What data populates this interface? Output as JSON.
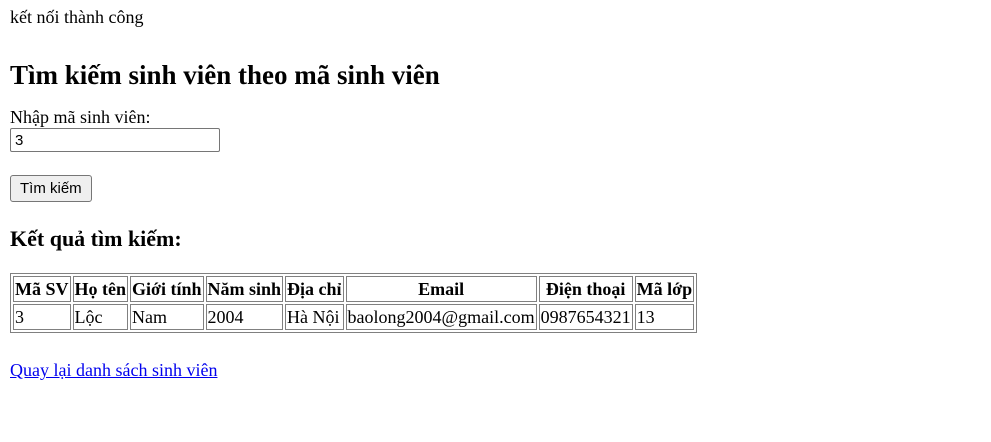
{
  "status_message": "kết nối thành công",
  "page_title": "Tìm kiếm sinh viên theo mã sinh viên",
  "search_form": {
    "label": "Nhập mã sinh viên:",
    "input_value": "3",
    "submit_label": "Tìm kiếm"
  },
  "results": {
    "heading": "Kết quả tìm kiếm:",
    "columns": [
      "Mã SV",
      "Họ tên",
      "Giới tính",
      "Năm sinh",
      "Địa chỉ",
      "Email",
      "Điện thoại",
      "Mã lớp"
    ],
    "rows": [
      [
        "3",
        "Lộc",
        "Nam",
        "2004",
        "Hà Nội",
        "baolong2004@gmail.com",
        "0987654321",
        "13"
      ]
    ]
  },
  "back_link_label": "Quay lại danh sách sinh viên",
  "colors": {
    "link": "#0000ee",
    "button_bg": "#efefef",
    "table_border": "#808080"
  }
}
